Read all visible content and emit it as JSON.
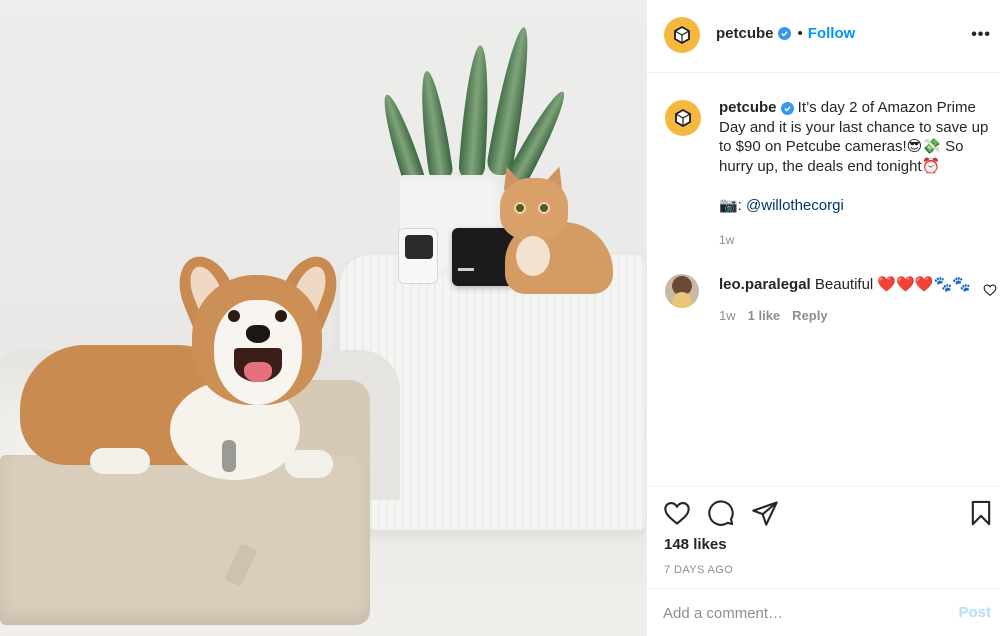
{
  "post_image": {
    "description_icon": "photo-corgi-cat-petcube"
  },
  "header": {
    "username": "petcube",
    "dot": "•",
    "follow_label": "Follow",
    "more_label": "•••"
  },
  "caption": {
    "username": "petcube",
    "text": " It’s day 2 of Amazon Prime Day and it is your last chance to save up to $90 on Petcube cameras!😎💸 So hurry up, the deals end tonight⏰",
    "camera_emoji": "📷: ",
    "mention": "@willothecorgi",
    "time": "1w"
  },
  "comments": [
    {
      "username": "leo.paralegal",
      "text": " Beautiful ❤️❤️❤️🐾🐾",
      "time": "1w",
      "likes": "1 like",
      "reply_label": "Reply"
    }
  ],
  "actions": {
    "likes": "148 likes",
    "posted": "7 DAYS AGO"
  },
  "comment_box": {
    "placeholder": "Add a comment…",
    "post_label": "Post"
  },
  "colors": {
    "accent": "#0095f6",
    "verified": "#3897f0",
    "brand_avatar": "#f5b83f",
    "muted": "#8e8e8e"
  }
}
